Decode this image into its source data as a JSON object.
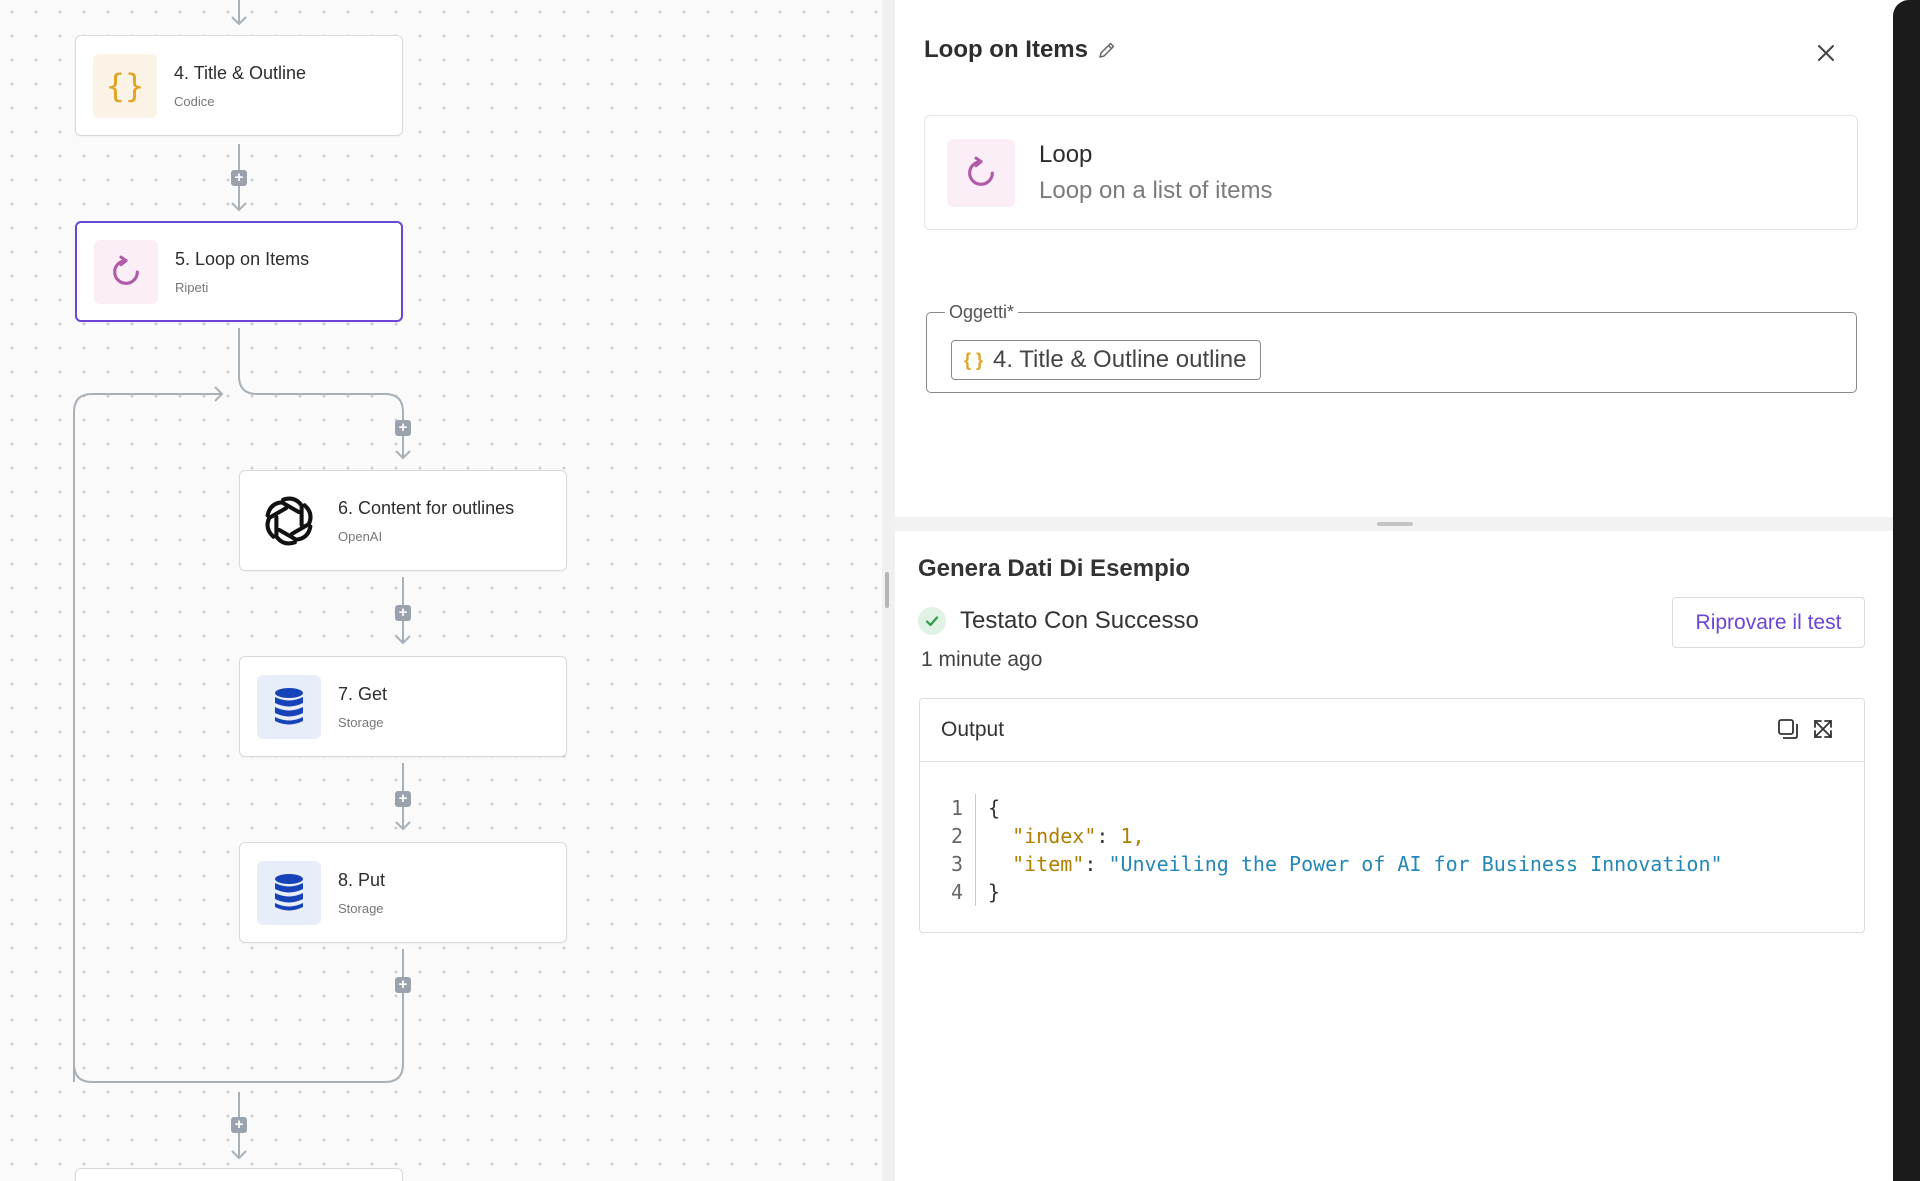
{
  "flow": {
    "nodes": [
      {
        "title": "4. Title & Outline",
        "subtitle": "Codice",
        "icon": "code-braces-icon"
      },
      {
        "title": "5. Loop on Items",
        "subtitle": "Ripeti",
        "icon": "loop-icon"
      },
      {
        "title": "6. Content for outlines",
        "subtitle": "OpenAI",
        "icon": "openai-icon"
      },
      {
        "title": "7. Get",
        "subtitle": "Storage",
        "icon": "database-icon"
      },
      {
        "title": "8. Put",
        "subtitle": "Storage",
        "icon": "database-icon"
      }
    ]
  },
  "panel": {
    "title": "Loop on Items",
    "piece": {
      "name": "Loop",
      "description": "Loop on a list of items"
    },
    "items_field": {
      "label": "Oggetti*",
      "chip_icon": "{ }",
      "chip_text": "4. Title & Outline outline"
    }
  },
  "sample": {
    "title": "Genera Dati Di Esempio",
    "status": "Testato Con Successo",
    "time": "1 minute ago",
    "retry_label": "Riprovare il test",
    "output": {
      "title": "Output",
      "lines": [
        {
          "n": "1",
          "text": "{"
        },
        {
          "n": "2",
          "key": "\"index\"",
          "value": "1,"
        },
        {
          "n": "3",
          "key": "\"item\"",
          "value": "\"Unveiling the Power of AI for Business Innovation\""
        },
        {
          "n": "4",
          "text": "}"
        }
      ]
    }
  },
  "colors": {
    "accent": "#6a45d6",
    "code_icon": "#e0a323",
    "loop_icon": "#b05aa8",
    "storage_icon": "#1743b8",
    "success": "#2e9d4a"
  }
}
